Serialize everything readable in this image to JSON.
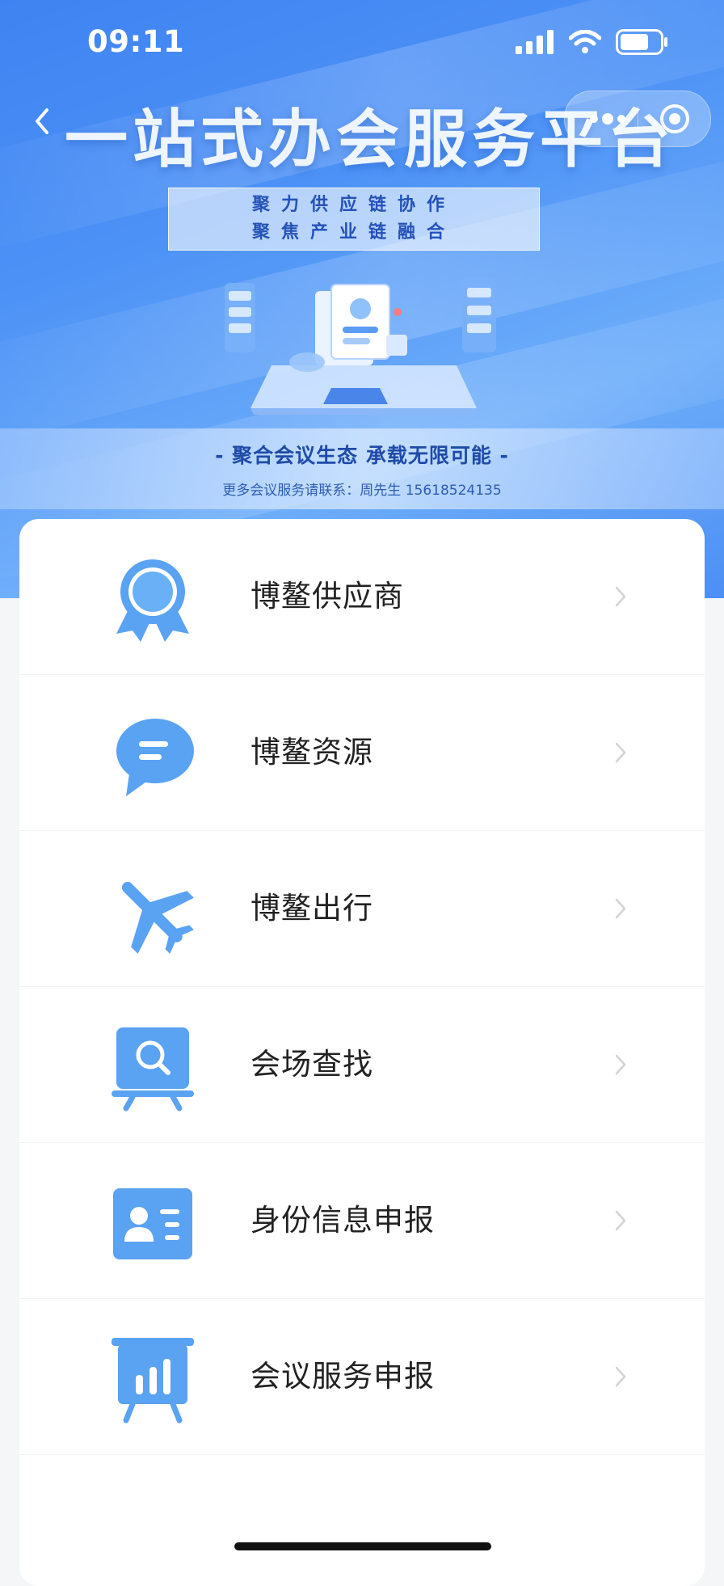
{
  "status_bar": {
    "time": "09:11",
    "icons": [
      "signal-icon",
      "wifi-icon",
      "battery-icon"
    ]
  },
  "nav": {
    "title": "一站式办会服务平台",
    "back_icon": "chevron-left-icon",
    "more_icon": "more-dots-icon",
    "close_icon": "target-icon"
  },
  "banner": {
    "slogan_line1": "聚力供应链协作",
    "slogan_line2": "聚焦产业链融合",
    "tagline": "- 聚合会议生态  承载无限可能 -",
    "contact": "更多会议服务请联系：周先生 15618524135"
  },
  "menu": {
    "items": [
      {
        "label": "博鳌供应商",
        "icon": "award-ribbon-icon"
      },
      {
        "label": "博鳌资源",
        "icon": "chat-bubble-icon"
      },
      {
        "label": "博鳌出行",
        "icon": "airplane-icon"
      },
      {
        "label": "会场查找",
        "icon": "board-search-icon"
      },
      {
        "label": "身份信息申报",
        "icon": "id-card-icon"
      },
      {
        "label": "会议服务申报",
        "icon": "board-chart-icon"
      }
    ]
  },
  "colors": {
    "accent": "#4a90f0",
    "icon": "#5aa2f2",
    "banner": "#3f83f2"
  }
}
